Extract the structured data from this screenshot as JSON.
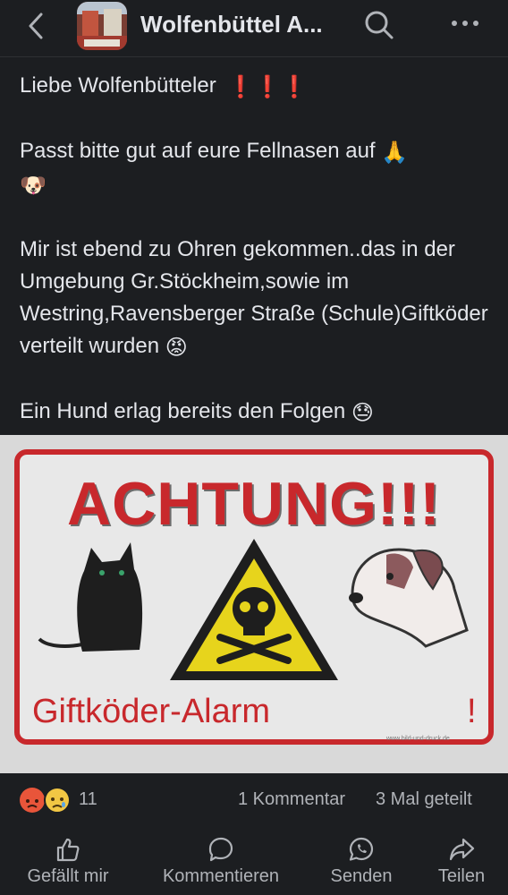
{
  "header": {
    "title": "Wolfenbüttel A...",
    "back_icon": "chevron-left-icon",
    "search_icon": "search-icon",
    "more_icon": "more-horizontal-icon"
  },
  "post": {
    "line1": "Liebe Wolfenbütteler",
    "line1_emoji": "❗❗❗",
    "line2": "Passt bitte gut auf eure Fellnasen auf",
    "line2_emoji1": "🙏",
    "line2_emoji2": "🐶",
    "line3": "Mir ist ebend zu Ohren gekommen..das in der Umgebung Gr.Stöckheim,sowie im Westring,Ravensberger Straße (Schule)Giftköder verteilt wurden",
    "line3_emoji": "😡",
    "line4": "Ein Hund erlag bereits den Folgen",
    "line4_emoji": "😓"
  },
  "image": {
    "headline": "ACHTUNG!!!",
    "subline": "Giftköder-Alarm",
    "bang": "!",
    "url": "www.bild-und-druck.de"
  },
  "stats": {
    "reaction_count": "11",
    "comments": "1 Kommentar",
    "shares": "3 Mal geteilt"
  },
  "actions": {
    "like": "Gefällt mir",
    "comment": "Kommentieren",
    "send": "Senden",
    "share": "Teilen"
  },
  "colors": {
    "background": "#1c1e21",
    "text": "#e4e6eb",
    "muted": "#b0b3b8",
    "sign_red": "#c8282c",
    "warning_yellow": "#e7d41c"
  }
}
